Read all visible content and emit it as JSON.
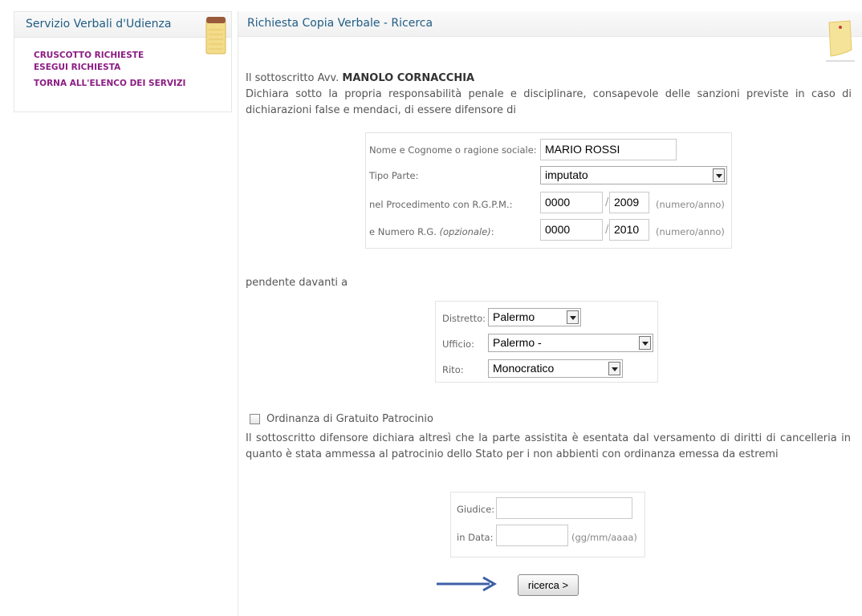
{
  "sidebar": {
    "title": "Servizio Verbali d'Udienza",
    "items": [
      {
        "label": "Cruscotto richieste"
      },
      {
        "label": "Esegui richiesta"
      },
      {
        "label": "Torna all'elenco dei servizi"
      }
    ]
  },
  "main": {
    "title": "Richiesta Copia Verbale - Ricerca",
    "intro_prefix": "Il sottoscritto Avv. ",
    "lawyer_name": "MANOLO CORNACCHIA",
    "declaration": "Dichiara sotto la propria responsabilità penale e disciplinare, consapevole delle sanzioni previste in caso di dichiarazioni false e mendaci, di essere difensore di",
    "party_form": {
      "name_label": "Nome e Cognome o ragione sociale:",
      "name_value": "MARIO ROSSI",
      "party_type_label": "Tipo Parte:",
      "party_type_value": "imputato",
      "rgpm_label": "nel Procedimento con R.G.P.M.:",
      "rgpm_number": "0000",
      "rgpm_year": "2009",
      "rg_label": "e Numero R.G. ",
      "rg_optional": "(opzionale)",
      "rg_label_suffix": ":",
      "rg_number": "0000",
      "rg_year": "2010",
      "number_year_hint": "(numero/anno)",
      "slash": "/"
    },
    "pending_text": "pendente davanti a",
    "court_form": {
      "district_label": "Distretto:",
      "district_value": "Palermo",
      "office_label": "Ufficio:",
      "office_value": "Palermo -",
      "rite_label": "Rito:",
      "rite_value": "Monocratico"
    },
    "legal_aid": {
      "checkbox_label": "Ordinanza di Gratuito Patrocinio",
      "checked": false,
      "text": "Il sottoscritto difensore dichiara altresì che la parte assistita è esentata dal versamento di diritti di cancelleria in quanto è stata ammessa al patrocinio dello Stato per i non abbienti con ordinanza emessa da estremi"
    },
    "ordinance_form": {
      "judge_label": "Giudice:",
      "judge_value": "",
      "date_label": "in Data:",
      "date_value": "",
      "date_hint": "(gg/mm/aaaa)"
    },
    "search_button": "ricerca >"
  },
  "colors": {
    "title_blue": "#1f5d85",
    "menu_purple": "#8b1d83",
    "pointer_arrow": "#3d5fa8"
  }
}
